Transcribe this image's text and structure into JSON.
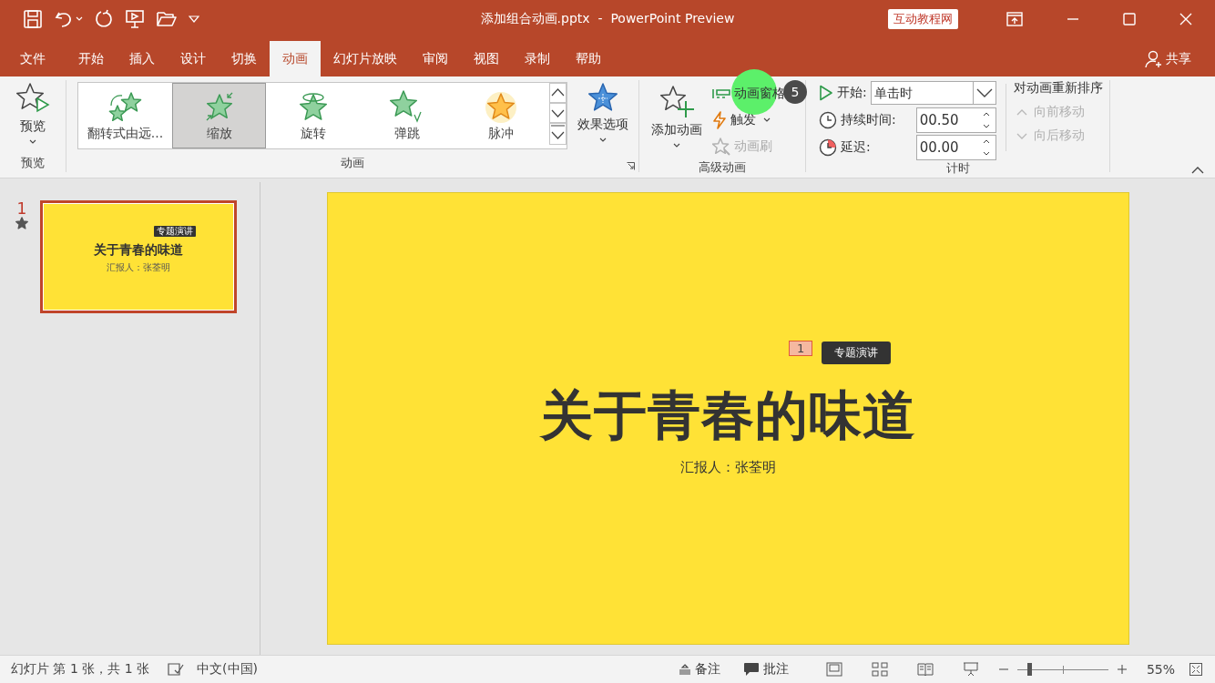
{
  "title_bar": {
    "title": "添加组合动画.pptx  -  PowerPoint Preview",
    "badge": "互动教程网"
  },
  "menu_tabs": [
    {
      "label": "文件",
      "selected": false
    },
    {
      "label": "开始",
      "selected": false
    },
    {
      "label": "插入",
      "selected": false
    },
    {
      "label": "设计",
      "selected": false
    },
    {
      "label": "切换",
      "selected": false
    },
    {
      "label": "动画",
      "selected": true
    },
    {
      "label": "幻灯片放映",
      "selected": false
    },
    {
      "label": "审阅",
      "selected": false
    },
    {
      "label": "视图",
      "selected": false
    },
    {
      "label": "录制",
      "selected": false
    },
    {
      "label": "帮助",
      "selected": false
    }
  ],
  "share": "共享",
  "ribbon": {
    "preview_group": {
      "button": "预览",
      "label": "预览"
    },
    "animation_group": {
      "label": "动画",
      "gallery": [
        {
          "label": "翻转式由远...",
          "kind": "flip",
          "selected": false
        },
        {
          "label": "缩放",
          "kind": "zoom",
          "selected": true
        },
        {
          "label": "旋转",
          "kind": "spin",
          "selected": false
        },
        {
          "label": "弹跳",
          "kind": "bounce",
          "selected": false
        },
        {
          "label": "脉冲",
          "kind": "pulse",
          "selected": false
        }
      ],
      "effect_options": "效果选项"
    },
    "advanced_group": {
      "label": "高级动画",
      "add_animation": "添加动画",
      "items": [
        {
          "label": "动画窗格",
          "kind": "pane",
          "disabled": false
        },
        {
          "label": "触发",
          "kind": "trigger",
          "disabled": false
        },
        {
          "label": "动画刷",
          "kind": "painter",
          "disabled": true
        }
      ]
    },
    "timing_group": {
      "label": "计时",
      "start_label": "开始:",
      "start_value": "单击时",
      "duration_label": "持续时间:",
      "duration_value": "00.50",
      "delay_label": "延迟:",
      "delay_value": "00.00",
      "reorder_title": "对动画重新排序",
      "reorder": [
        {
          "label": "向前移动",
          "kind": "up",
          "disabled": true
        },
        {
          "label": "向后移动",
          "kind": "down",
          "disabled": true
        }
      ]
    }
  },
  "click_badge": "5",
  "thumbnails": [
    {
      "number": "1",
      "selected": true,
      "tag": "专题演讲",
      "title": "关于青春的味道",
      "subtitle": "汇报人：张荃明"
    }
  ],
  "slide": {
    "animation_marker": "1",
    "tag": "专题演讲",
    "title": "关于青春的味道",
    "subtitle": "汇报人：张荃明"
  },
  "status_bar": {
    "slide_info": "幻灯片 第 1 张，共 1 张",
    "language": "中文(中国)",
    "notes": "备注",
    "comments": "批注",
    "zoom_slider": {
      "level": 0.13
    },
    "zoom": "55%"
  }
}
